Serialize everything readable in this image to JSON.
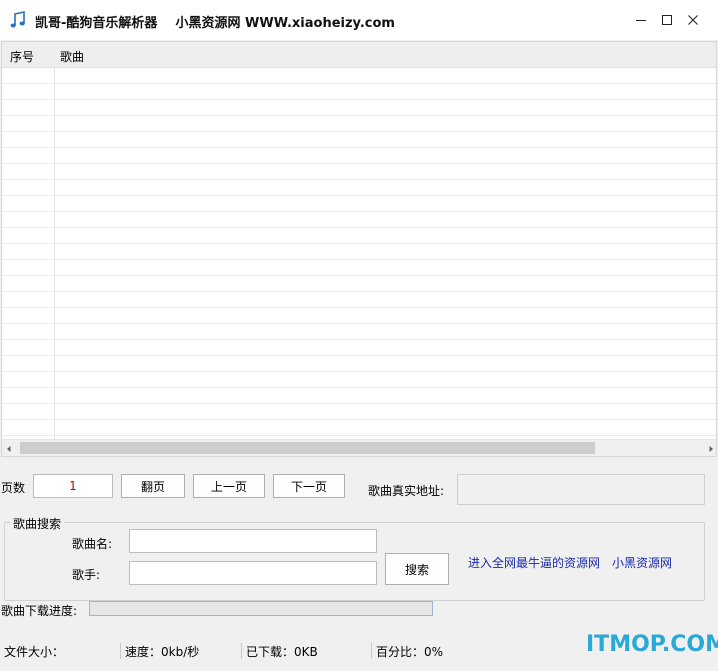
{
  "window": {
    "title": "凯哥-酷狗音乐解析器    小黑资源网 WWW.xiaoheizy.com",
    "icon": "music-note-icon"
  },
  "list": {
    "columns": [
      "序号",
      "歌曲"
    ]
  },
  "paging": {
    "page_label": "页数",
    "page_value": "1",
    "flip_button": "翻页",
    "prev_button": "上一页",
    "next_button": "下一页",
    "real_url_label": "歌曲真实地址:",
    "real_url_value": ""
  },
  "search": {
    "group_title": "歌曲搜索",
    "song_name_label": "歌曲名:",
    "song_name_value": "",
    "singer_label": "歌手:",
    "singer_value": "",
    "search_button": "搜索",
    "link_all": "进入全网最牛逼的资源网",
    "link_site": "小黑资源网"
  },
  "download": {
    "progress_label": "歌曲下载进度:",
    "progress_fraction": 0
  },
  "status": {
    "file_size": "文件大小：",
    "speed": "速度：0kb/秒",
    "downloaded": "已下载：0KB",
    "percent": "百分比：0%"
  },
  "watermark": "ITMOP.COM",
  "colors": {
    "page_value_text": "#c00000",
    "link": "#1a2aa8",
    "watermark": "#2aa9d6"
  }
}
